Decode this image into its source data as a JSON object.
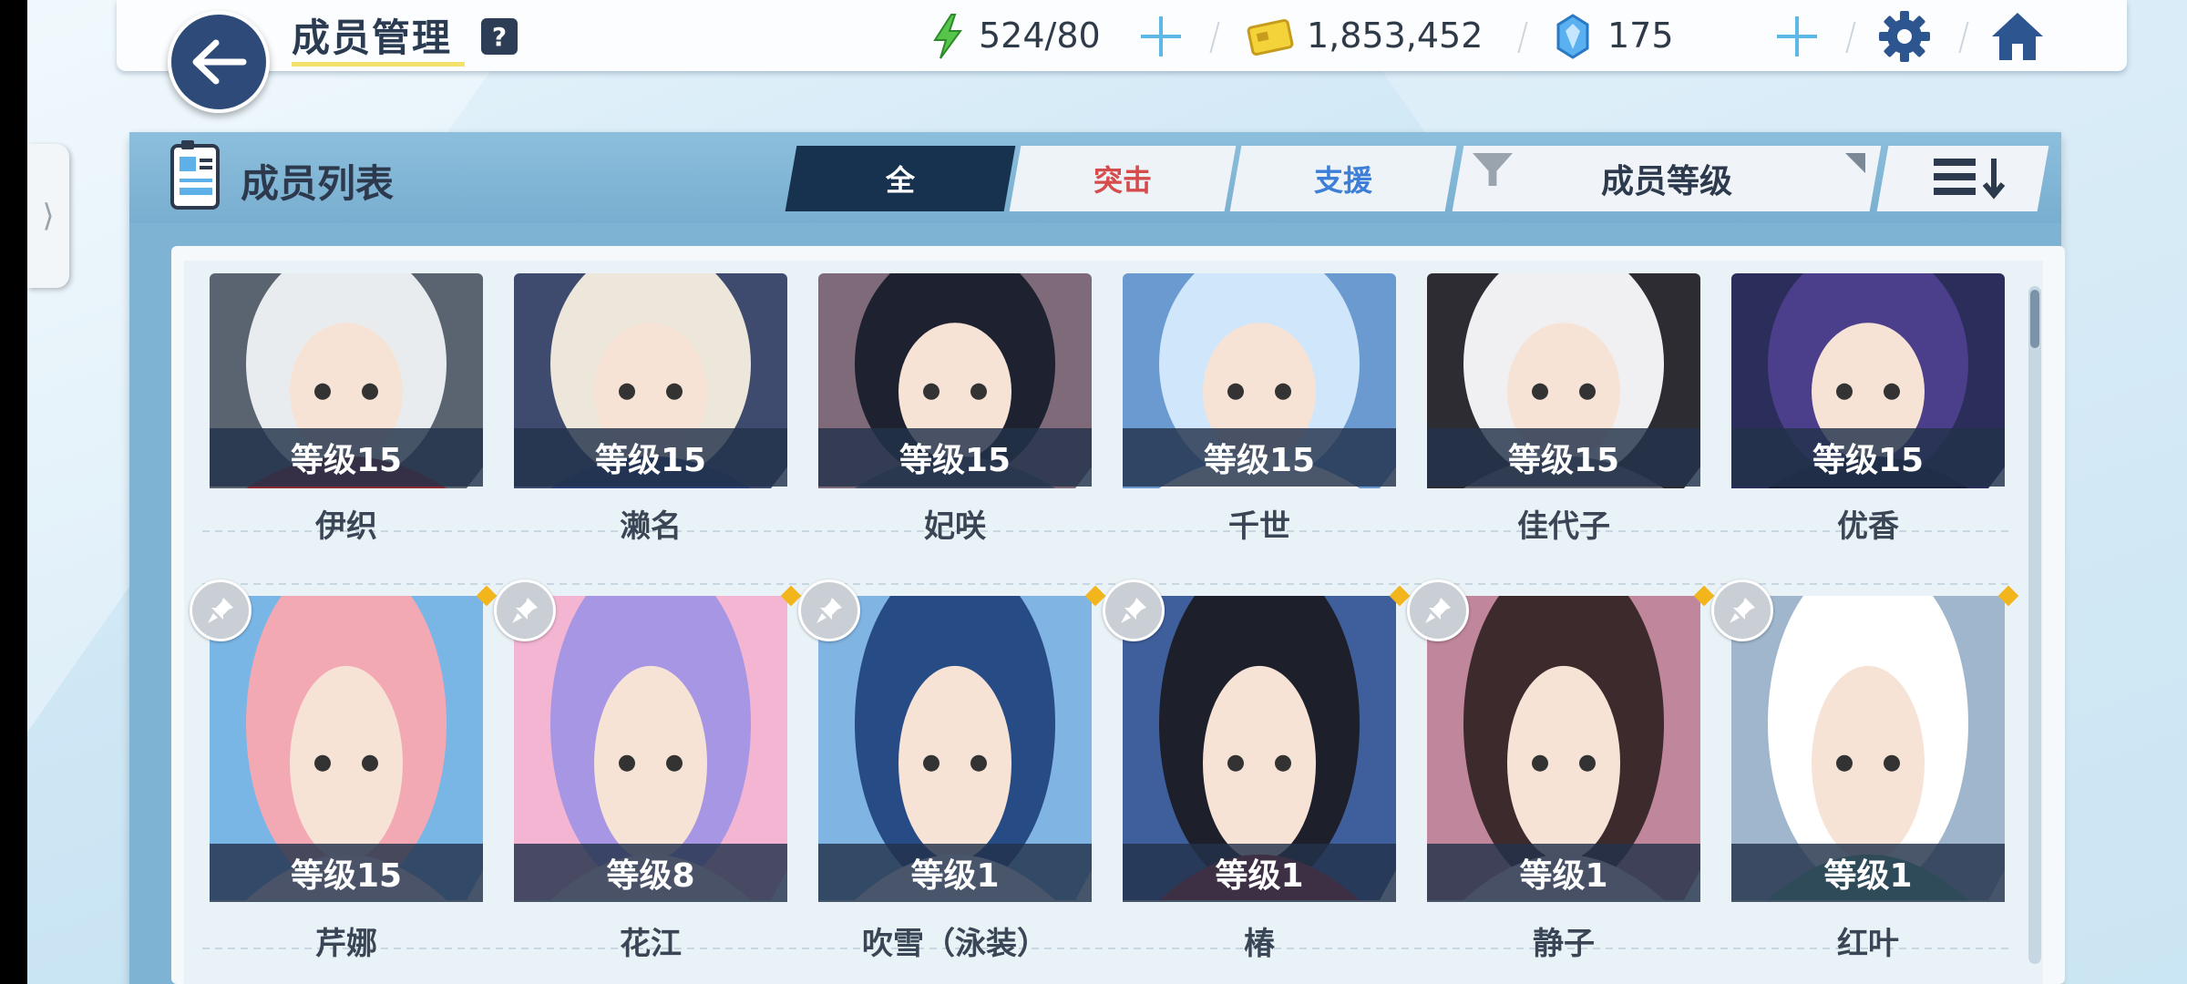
{
  "header": {
    "title": "成员管理",
    "help": "?",
    "resources": {
      "ap": "524/80",
      "credits": "1,853,452",
      "pyroxene": "175"
    }
  },
  "panel": {
    "title": "成员列表",
    "tabs": [
      "全",
      "突击",
      "支援"
    ],
    "sort_label": "成员等级"
  },
  "students": [
    {
      "name": "伊织",
      "level": "等级15",
      "colors": [
        "#5a6470",
        "#e9ecef",
        "#8b2a30"
      ]
    },
    {
      "name": "濑名",
      "level": "等级15",
      "colors": [
        "#3f4b6e",
        "#ece7da",
        "#2a3e7a"
      ]
    },
    {
      "name": "妃咲",
      "level": "等级15",
      "colors": [
        "#7f6a7a",
        "#1e2230",
        "#4a4e66"
      ]
    },
    {
      "name": "千世",
      "level": "等级15",
      "colors": [
        "#6a9ad0",
        "#cfe6fb",
        "#ffffff"
      ]
    },
    {
      "name": "佳代子",
      "level": "等级15",
      "colors": [
        "#2d2c33",
        "#f0f0f2",
        "#6b6a72"
      ]
    },
    {
      "name": "优香",
      "level": "等级15",
      "colors": [
        "#2b2d5a",
        "#4b3f8c",
        "#18203a"
      ]
    },
    {
      "name": "芹娜",
      "level": "等级15",
      "colors": [
        "#79b6e6",
        "#f3a9b3",
        "#fbe6ea"
      ]
    },
    {
      "name": "花江",
      "level": "等级8",
      "colors": [
        "#f3b5d2",
        "#a696e3",
        "#fde3ee"
      ]
    },
    {
      "name": "吹雪（泳装）",
      "level": "等级1",
      "colors": [
        "#7fb4e3",
        "#274b85",
        "#f2f4fb"
      ]
    },
    {
      "name": "椿",
      "level": "等级1",
      "colors": [
        "#3e5f9c",
        "#1d1f2a",
        "#b7282d"
      ]
    },
    {
      "name": "静子",
      "level": "等级1",
      "colors": [
        "#c0869c",
        "#3c2a2c",
        "#f1d5e0"
      ]
    },
    {
      "name": "红叶",
      "level": "等级1",
      "colors": [
        "#9fb6cc",
        "#ffffff",
        "#69b99a"
      ]
    }
  ]
}
